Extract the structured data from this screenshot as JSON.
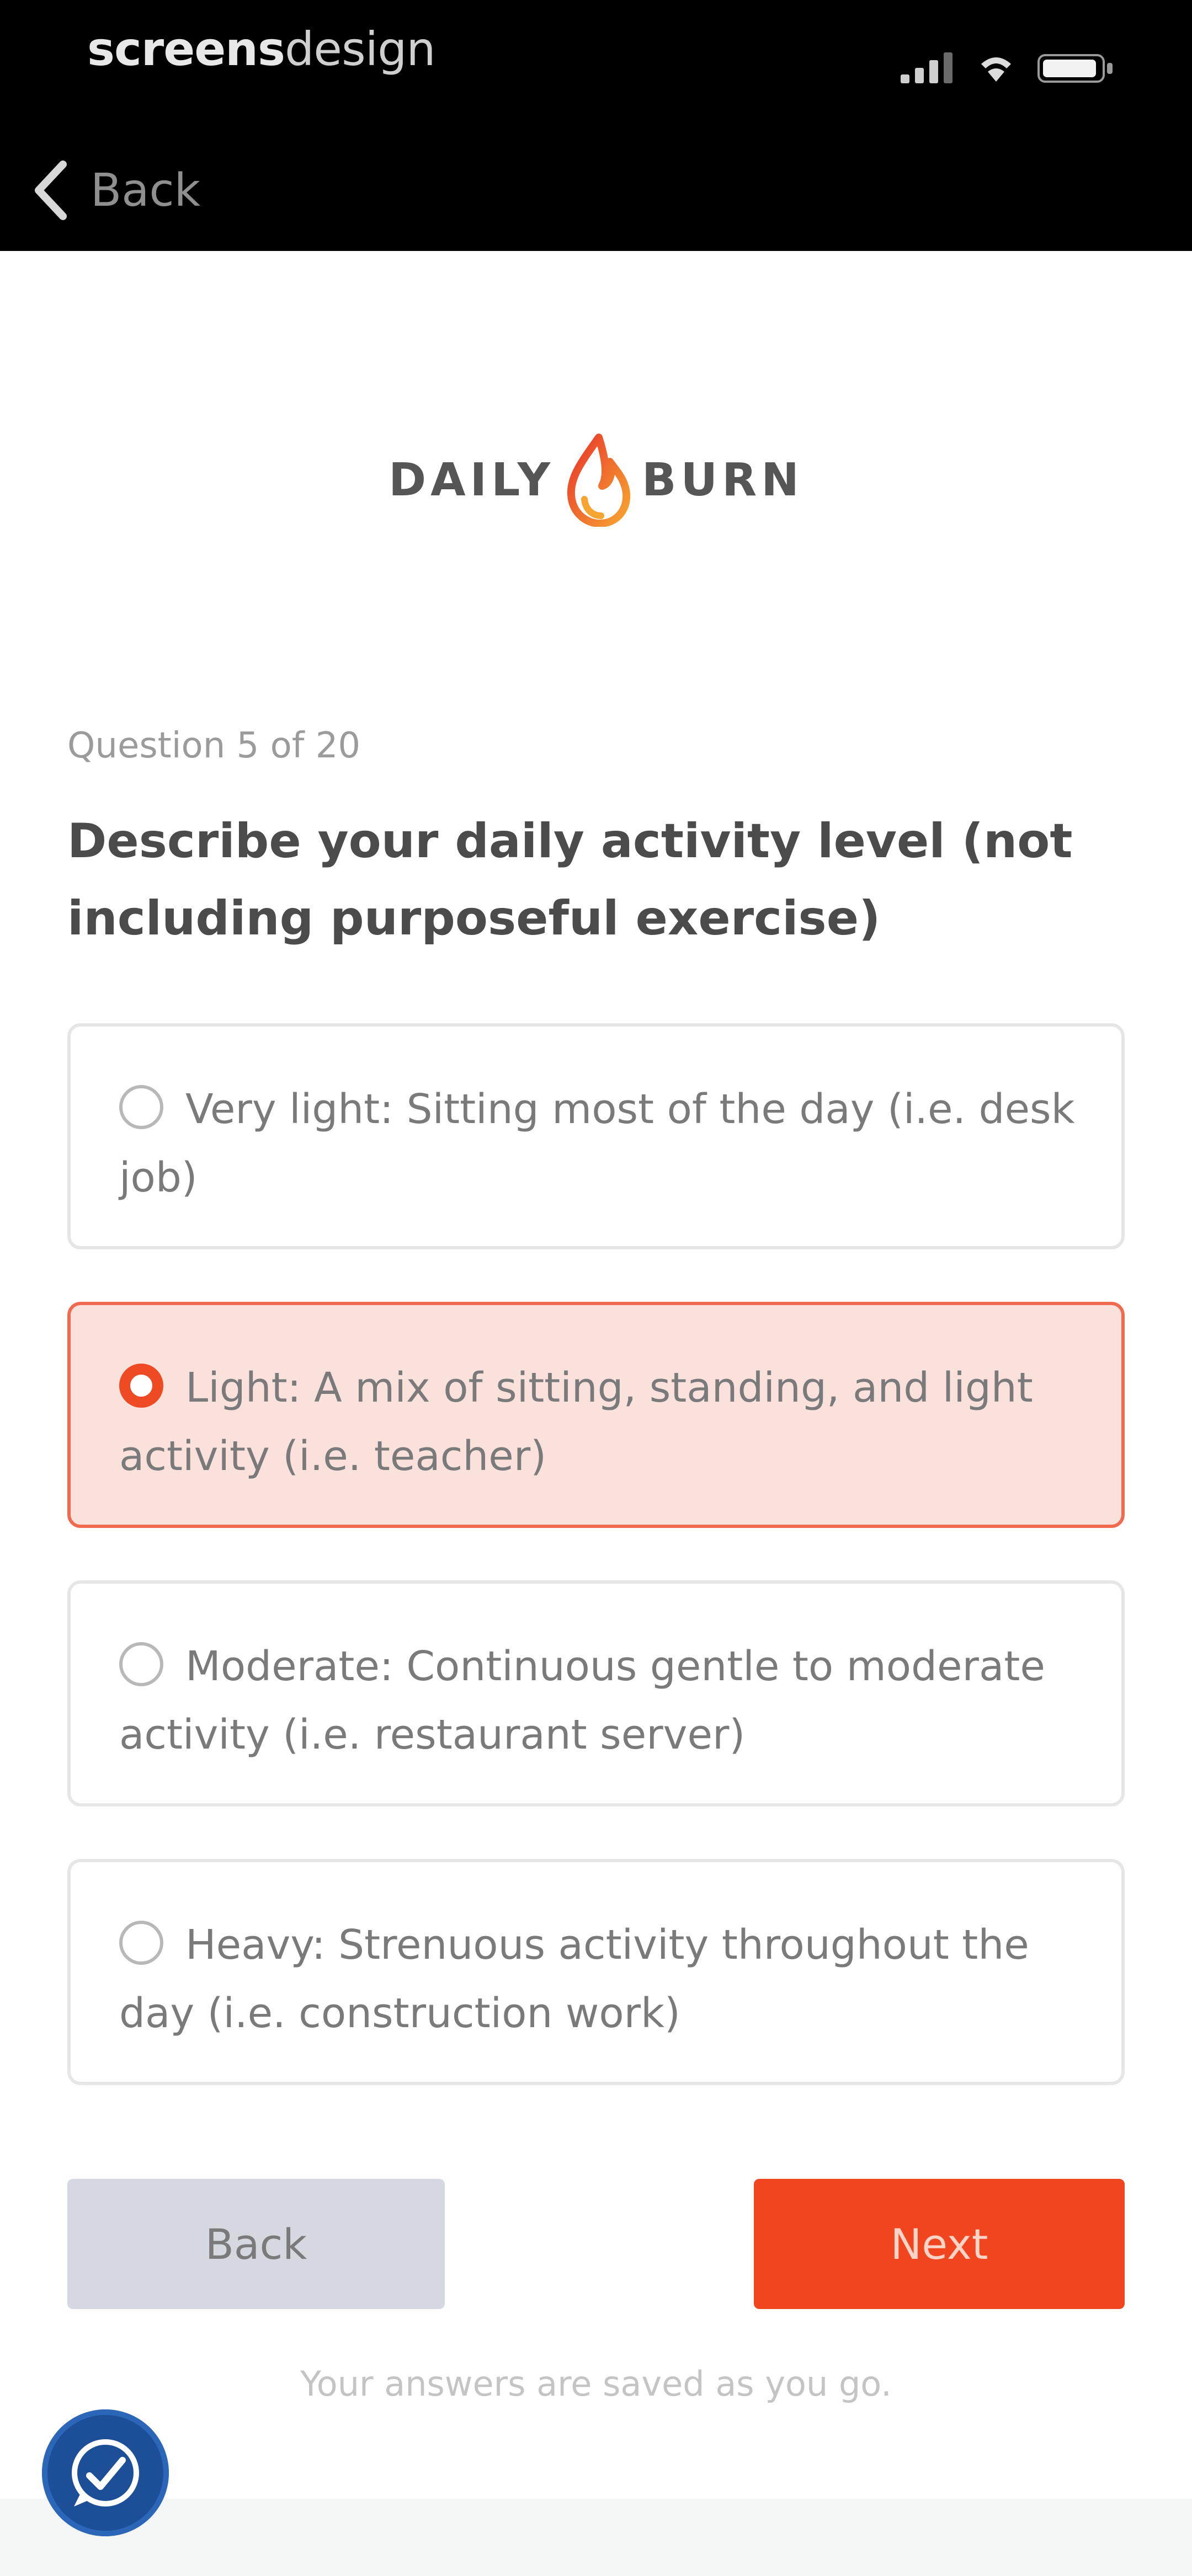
{
  "status_bar": {
    "carrier_bold": "screens",
    "carrier_light": "design",
    "icons": [
      "signal-icon",
      "wifi-icon",
      "battery-icon"
    ]
  },
  "nav": {
    "back_label": "Back",
    "back_icon": "chevron-left-icon"
  },
  "brand": {
    "word_left": "DAILY",
    "word_right": "BURN",
    "flame_icon": "flame-icon",
    "accent_color": "#f0451f"
  },
  "question": {
    "meta": "Question 5 of 20",
    "title": "Describe your daily activity level (not including purposeful exercise)"
  },
  "options": [
    {
      "label": "Very light: Sitting most of the day (i.e. desk job)",
      "selected": false
    },
    {
      "label": "Light: A mix of sitting, standing, and light activity (i.e. teacher)",
      "selected": true
    },
    {
      "label": "Moderate: Continuous gentle to moderate activity (i.e. restaurant server)",
      "selected": false
    },
    {
      "label": "Heavy: Strenuous activity throughout the day (i.e. construction work)",
      "selected": false
    }
  ],
  "actions": {
    "back_label": "Back",
    "next_label": "Next"
  },
  "footer": {
    "note": "Your answers are saved as you go.",
    "help_icon": "help-chat-icon"
  }
}
